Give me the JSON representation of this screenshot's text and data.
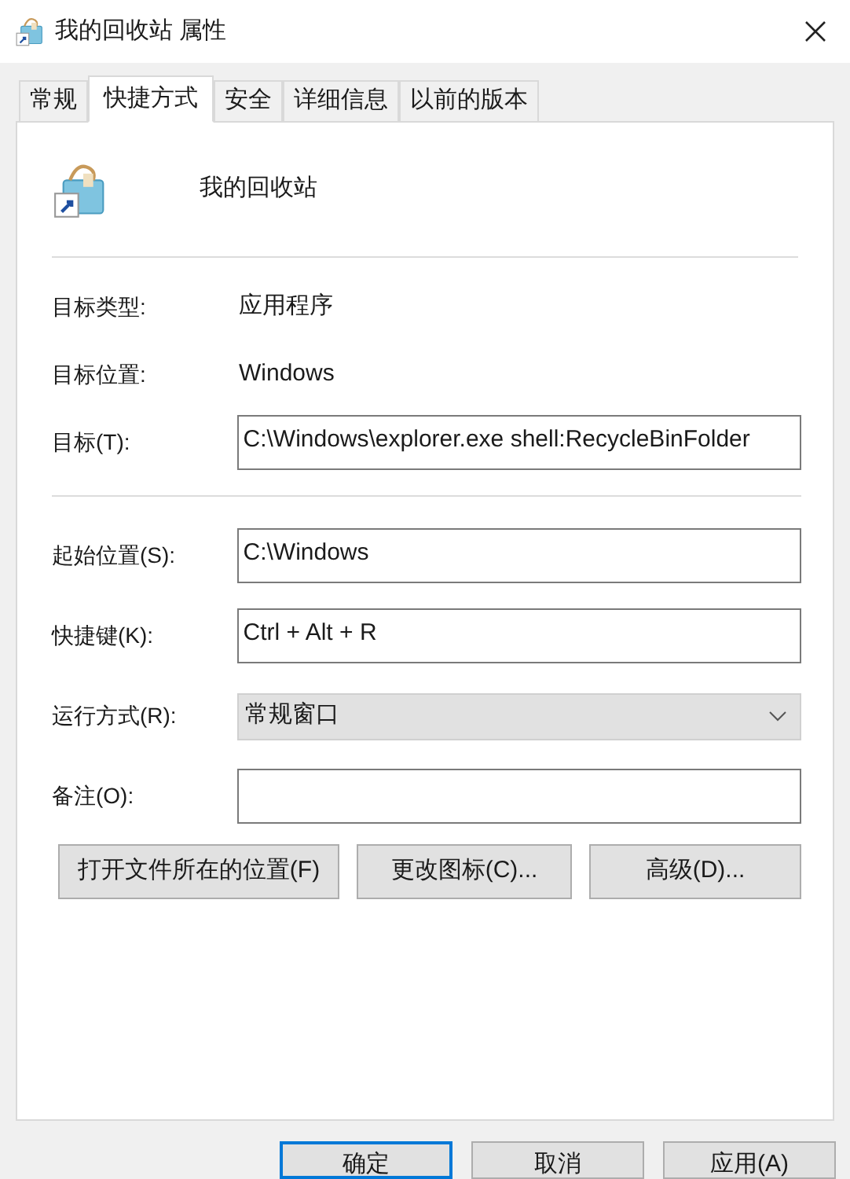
{
  "window": {
    "title": "我的回收站 属性"
  },
  "tabs": [
    {
      "label": "常规",
      "selected": false
    },
    {
      "label": "快捷方式",
      "selected": true
    },
    {
      "label": "安全",
      "selected": false
    },
    {
      "label": "详细信息",
      "selected": false
    },
    {
      "label": "以前的版本",
      "selected": false
    }
  ],
  "shortcut_name": "我的回收站",
  "sections": [
    [
      {
        "kind": "text",
        "label": "目标类型:",
        "value": "应用程序"
      },
      {
        "kind": "text",
        "label": "目标位置:",
        "value": "Windows"
      },
      {
        "kind": "field",
        "label": "目标(T):",
        "value": "C:\\Windows\\explorer.exe shell:RecycleBinFolder"
      }
    ],
    [
      {
        "kind": "field",
        "label": "起始位置(S):",
        "value": "C:\\Windows"
      },
      {
        "kind": "field",
        "label": "快捷键(K):",
        "value": "Ctrl + Alt + R"
      },
      {
        "kind": "dropdown",
        "label": "运行方式(R):",
        "value": "常规窗口"
      },
      {
        "kind": "field",
        "label": "备注(O):"
      }
    ]
  ],
  "buttons": [
    "打开文件所在的位置(F)",
    "更改图标(C)...",
    "高级(D)..."
  ],
  "dialog_buttons": [
    {
      "label": "确定",
      "default": true
    },
    {
      "label": "取消",
      "default": false
    },
    {
      "label": "应用(A)",
      "default": false
    }
  ]
}
